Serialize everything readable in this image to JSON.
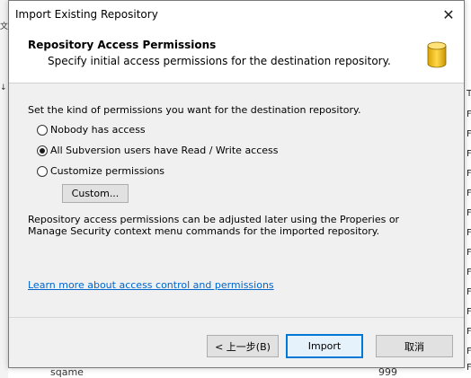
{
  "dialog": {
    "title": "Import Existing Repository",
    "close_glyph": "✕"
  },
  "header": {
    "title": "Repository Access Permissions",
    "subtitle": "Specify initial access permissions for the destination repository.",
    "icon": "database-icon"
  },
  "body": {
    "instruction": "Set the kind of permissions you want for the destination repository.",
    "options": [
      {
        "label": "Nobody has access",
        "selected": false
      },
      {
        "label": "All Subversion users have Read / Write access",
        "selected": true
      },
      {
        "label": "Customize permissions",
        "selected": false
      }
    ],
    "custom_button": "Custom...",
    "note": "Repository access permissions can be adjusted later using the Properies or Manage Security context menu commands for the imported repository.",
    "learn_more": "Learn more about access control and permissions"
  },
  "footer": {
    "back": "< 上一步(B)",
    "import": "Import",
    "cancel": "取消"
  },
  "background": {
    "left_glyphs": [
      "文",
      "↓"
    ],
    "right_header": "T",
    "right_rows": [
      "F",
      "F",
      "F",
      "F",
      "F",
      "F",
      "F",
      "F",
      "F",
      "F",
      "F",
      "F",
      "F",
      "F"
    ],
    "bottom_text": "sqame",
    "bottom_number": "999"
  },
  "colors": {
    "accent": "#0078d7",
    "link": "#0066cc",
    "dialog_bg": "#f0f0f0"
  }
}
